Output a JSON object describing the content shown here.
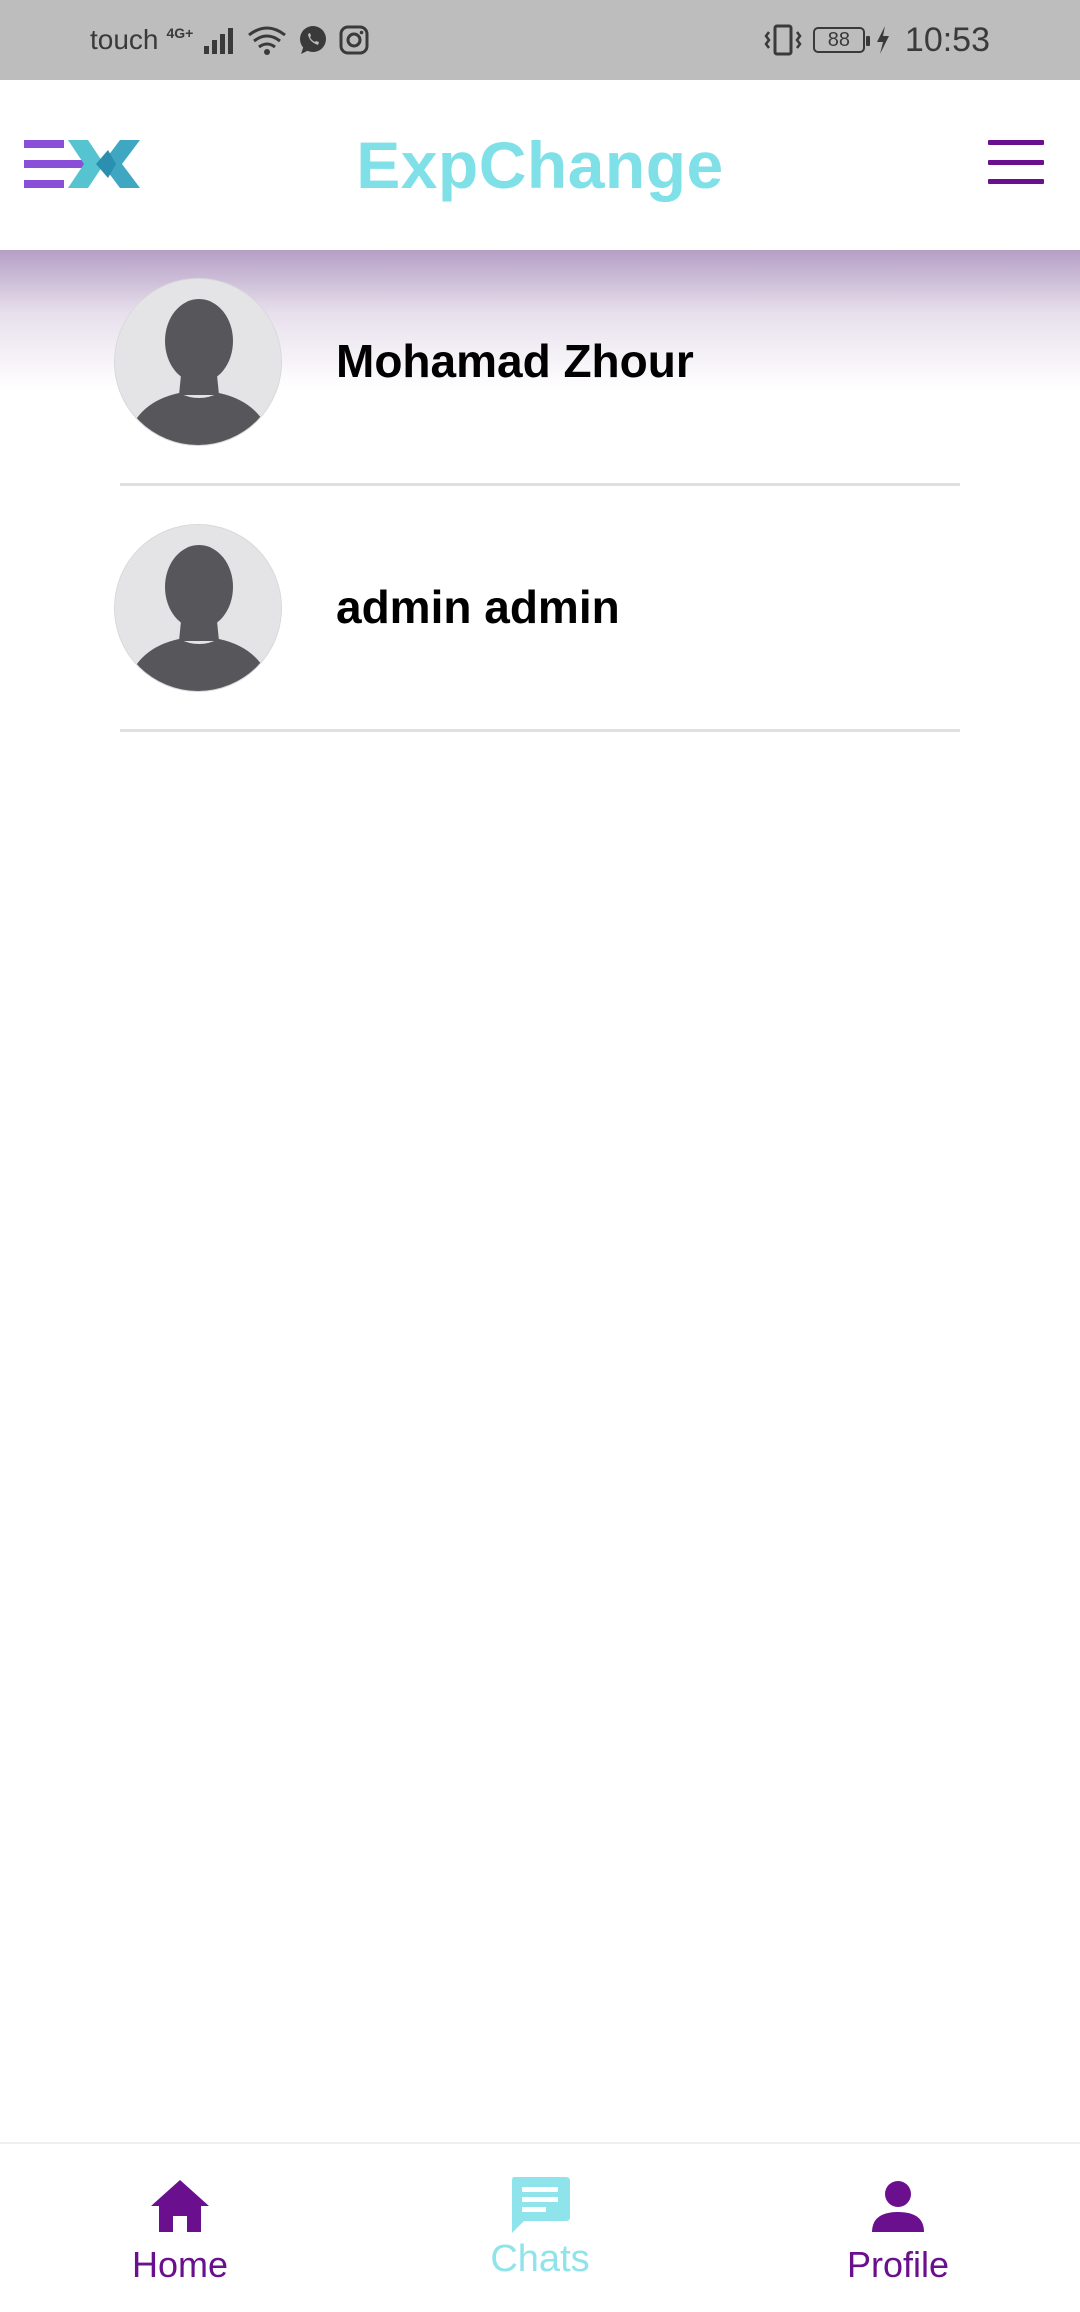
{
  "status_bar": {
    "carrier": "touch",
    "network_type": "4G+",
    "battery": "88",
    "time": "10:53",
    "icons": [
      "signal-icon",
      "wifi-icon",
      "whatsapp-icon",
      "instagram-icon",
      "vibrate-icon",
      "battery-icon",
      "charging-icon"
    ]
  },
  "header": {
    "title": "ExpChange",
    "logo_icon": "expchange-logo-icon",
    "menu_icon": "hamburger-menu-icon",
    "colors": {
      "title": "#7fe0e8",
      "menu": "#6a0f8e"
    }
  },
  "chats": [
    {
      "name": "Mohamad Zhour",
      "avatar_icon": "default-avatar-icon"
    },
    {
      "name": "admin admin",
      "avatar_icon": "default-avatar-icon"
    }
  ],
  "bottom_nav": {
    "items": [
      {
        "label": "Home",
        "icon": "home-icon",
        "active": false
      },
      {
        "label": "Chats",
        "icon": "chat-icon",
        "active": true
      },
      {
        "label": "Profile",
        "icon": "person-icon",
        "active": false
      }
    ],
    "colors": {
      "inactive": "#6a0f8e",
      "active": "#8fe3ea"
    }
  }
}
